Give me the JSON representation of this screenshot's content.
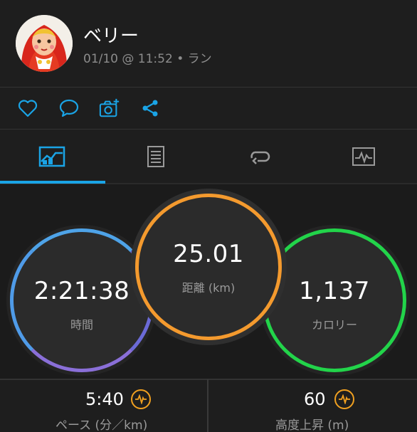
{
  "activity": {
    "user_name": "ベリー",
    "meta": "01/10 @ 11:52 • ラン"
  },
  "actions": [
    {
      "name": "like",
      "icon": "heart-icon"
    },
    {
      "name": "comment",
      "icon": "comment-icon"
    },
    {
      "name": "add-photo",
      "icon": "camera-plus-icon"
    },
    {
      "name": "share",
      "icon": "share-icon"
    }
  ],
  "tabs": [
    {
      "name": "overview",
      "icon": "overview-chart-icon",
      "active": true
    },
    {
      "name": "stats",
      "icon": "document-list-icon",
      "active": false
    },
    {
      "name": "laps",
      "icon": "loop-icon",
      "active": false
    },
    {
      "name": "graphs",
      "icon": "activity-graph-icon",
      "active": false
    }
  ],
  "stats": {
    "time": {
      "value": "2:21:38",
      "label": "時間"
    },
    "distance": {
      "value": "25.01",
      "label": "距離 (km)"
    },
    "calories": {
      "value": "1,137",
      "label": "カロリー"
    }
  },
  "bottom_metrics": {
    "pace": {
      "value": "5:40",
      "label": "ペース (分／km)"
    },
    "elevation": {
      "value": "60",
      "label": "高度上昇 (m)"
    }
  },
  "colors": {
    "accent": "#1aa4e6",
    "time_ring": "#4ea3e8",
    "distance_ring": "#f49a2e",
    "calories_ring": "#22d44a",
    "metric_icon": "#f0a020"
  }
}
